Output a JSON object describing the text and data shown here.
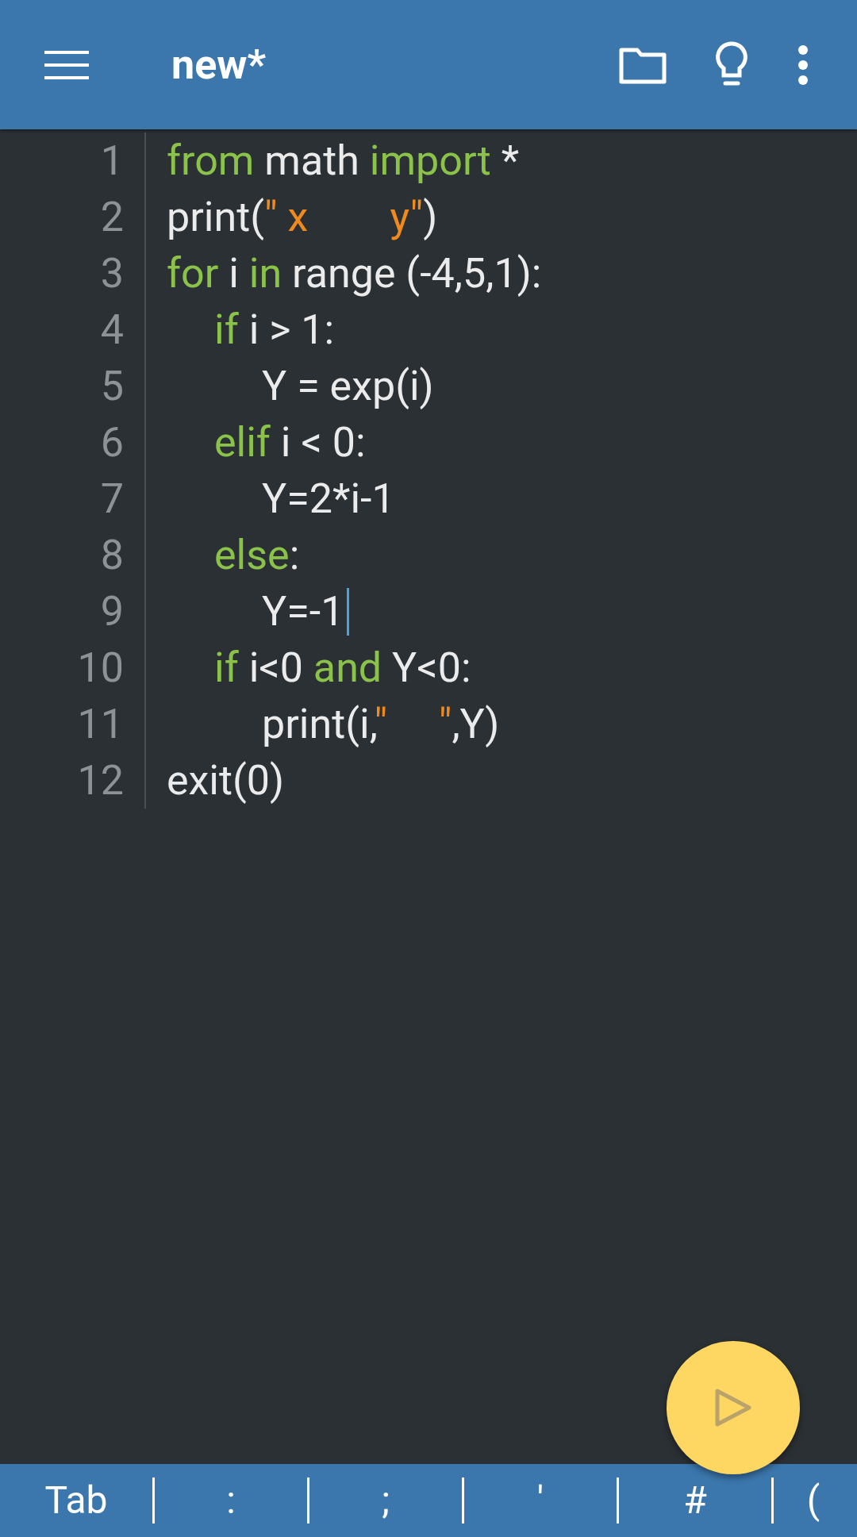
{
  "app_bar": {
    "title": "new*"
  },
  "editor": {
    "lines": [
      {
        "number": "1",
        "cursor": false,
        "tokens": [
          {
            "text": "from",
            "kind": "keyword"
          },
          {
            "text": " math ",
            "kind": "plain"
          },
          {
            "text": "import",
            "kind": "keyword"
          },
          {
            "text": " *",
            "kind": "plain"
          }
        ]
      },
      {
        "number": "2",
        "cursor": false,
        "tokens": [
          {
            "text": "print(",
            "kind": "plain"
          },
          {
            "text": "\" x        y\"",
            "kind": "string"
          },
          {
            "text": ")",
            "kind": "plain"
          }
        ]
      },
      {
        "number": "3",
        "cursor": false,
        "tokens": [
          {
            "text": "for",
            "kind": "keyword"
          },
          {
            "text": " i ",
            "kind": "plain"
          },
          {
            "text": "in",
            "kind": "keyword"
          },
          {
            "text": " range (-4,5,1):",
            "kind": "plain"
          }
        ],
        "children": [
          {
            "number": "4",
            "cursor": false,
            "tokens": [
              {
                "text": "if",
                "kind": "keyword"
              },
              {
                "text": " i > 1:",
                "kind": "plain"
              }
            ],
            "children": [
              {
                "number": "5",
                "cursor": false,
                "tokens": [
                  {
                    "text": "Y = exp(i)",
                    "kind": "plain"
                  }
                ]
              }
            ]
          },
          {
            "number": "6",
            "cursor": false,
            "tokens": [
              {
                "text": "elif",
                "kind": "keyword"
              },
              {
                "text": " i < 0:",
                "kind": "plain"
              }
            ],
            "children": [
              {
                "number": "7",
                "cursor": false,
                "tokens": [
                  {
                    "text": "Y=2*i-1",
                    "kind": "plain"
                  }
                ]
              }
            ]
          },
          {
            "number": "8",
            "cursor": false,
            "tokens": [
              {
                "text": "else",
                "kind": "keyword"
              },
              {
                "text": ":",
                "kind": "plain"
              }
            ],
            "children": [
              {
                "number": "9",
                "cursor": true,
                "tokens": [
                  {
                    "text": "Y=-1",
                    "kind": "plain"
                  }
                ]
              }
            ]
          },
          {
            "number": "10",
            "cursor": false,
            "tokens": [
              {
                "text": "if",
                "kind": "keyword"
              },
              {
                "text": " i<0 ",
                "kind": "plain"
              },
              {
                "text": "and",
                "kind": "keyword"
              },
              {
                "text": " Y<0:",
                "kind": "plain"
              }
            ],
            "children": [
              {
                "number": "11",
                "cursor": false,
                "tokens": [
                  {
                    "text": "print(i,",
                    "kind": "plain"
                  },
                  {
                    "text": "\"     \"",
                    "kind": "string"
                  },
                  {
                    "text": ",Y)",
                    "kind": "plain"
                  }
                ]
              }
            ]
          }
        ]
      },
      {
        "number": "12",
        "cursor": false,
        "tokens": [
          {
            "text": "exit(0)",
            "kind": "plain"
          }
        ]
      }
    ]
  },
  "key_bar": {
    "keys": [
      "Tab",
      ":",
      ";",
      "'",
      "#",
      "("
    ]
  }
}
